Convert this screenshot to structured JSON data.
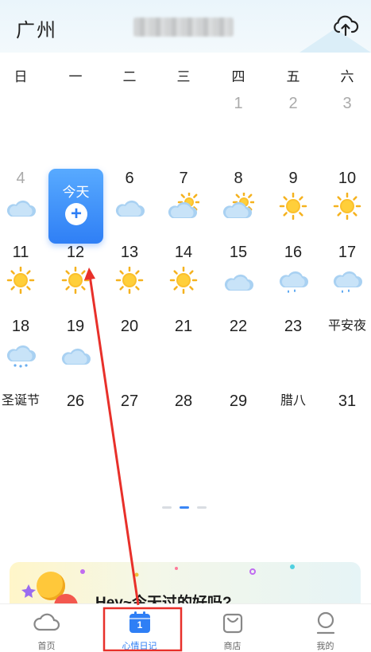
{
  "header": {
    "city": "广州"
  },
  "weekdays": [
    "日",
    "一",
    "二",
    "三",
    "四",
    "五",
    "六"
  ],
  "today_label": "今天",
  "today_action": "+",
  "weeks": [
    [
      {
        "label": "",
        "icon": ""
      },
      {
        "label": "",
        "icon": ""
      },
      {
        "label": "",
        "icon": ""
      },
      {
        "label": "",
        "icon": ""
      },
      {
        "label": "1",
        "icon": "",
        "dim": true
      },
      {
        "label": "2",
        "icon": "",
        "dim": true
      },
      {
        "label": "3",
        "icon": "",
        "dim": true
      }
    ],
    [
      {
        "label": "4",
        "icon": "cloudy-icon",
        "dim": true
      },
      {
        "label": "",
        "icon": ""
      },
      {
        "label": "6",
        "icon": "cloudy-icon"
      },
      {
        "label": "7",
        "icon": "partly-sunny-icon"
      },
      {
        "label": "8",
        "icon": "partly-sunny-icon"
      },
      {
        "label": "9",
        "icon": "sunny-icon"
      },
      {
        "label": "10",
        "icon": "sunny-icon"
      }
    ],
    [
      {
        "label": "11",
        "icon": "sunny-icon"
      },
      {
        "label": "12",
        "icon": "sunny-icon"
      },
      {
        "label": "13",
        "icon": "sunny-icon"
      },
      {
        "label": "14",
        "icon": "sunny-icon"
      },
      {
        "label": "15",
        "icon": "cloudy-icon"
      },
      {
        "label": "16",
        "icon": "rain-icon"
      },
      {
        "label": "17",
        "icon": "rain-icon"
      }
    ],
    [
      {
        "label": "18",
        "icon": "snow-icon"
      },
      {
        "label": "19",
        "icon": "cloudy-icon"
      },
      {
        "label": "20",
        "icon": ""
      },
      {
        "label": "21",
        "icon": ""
      },
      {
        "label": "22",
        "icon": ""
      },
      {
        "label": "23",
        "icon": ""
      },
      {
        "label": "平安夜",
        "icon": "",
        "festival": true
      }
    ],
    [
      {
        "label": "圣诞节",
        "icon": "",
        "festival": true
      },
      {
        "label": "26",
        "icon": ""
      },
      {
        "label": "27",
        "icon": ""
      },
      {
        "label": "28",
        "icon": ""
      },
      {
        "label": "29",
        "icon": ""
      },
      {
        "label": "腊八",
        "icon": "",
        "festival": true
      },
      {
        "label": "31",
        "icon": ""
      }
    ]
  ],
  "pager": {
    "pages": 3,
    "active": 1
  },
  "banner": {
    "text": "Hey~今天过的好吗?"
  },
  "tabs": [
    {
      "label": "首页",
      "icon": "cloud-icon",
      "active": false
    },
    {
      "label": "心情日记",
      "icon": "calendar-icon",
      "badge": "1",
      "active": true
    },
    {
      "label": "商店",
      "icon": "shopping-bag-icon",
      "active": false
    },
    {
      "label": "我的",
      "icon": "profile-icon",
      "active": false
    }
  ],
  "colors": {
    "accent": "#2f7ff5",
    "annotation": "#e8302a"
  }
}
